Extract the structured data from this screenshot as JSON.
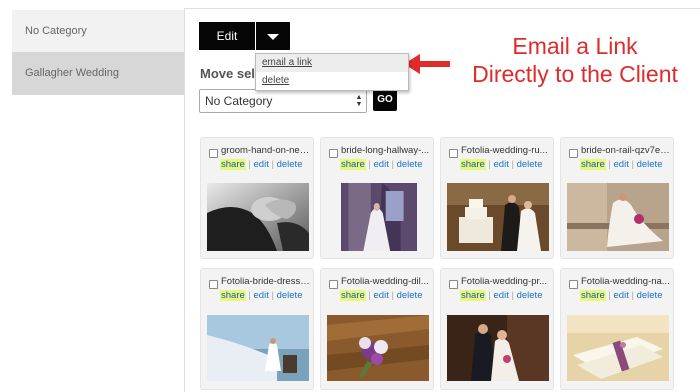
{
  "sidebar": {
    "items": [
      {
        "label": "No Category"
      },
      {
        "label": "Gallagher Wedding"
      }
    ]
  },
  "toolbar": {
    "edit_label": "Edit",
    "menu": {
      "items": [
        {
          "label": "email a link"
        },
        {
          "label": "delete"
        }
      ]
    },
    "move_label": "Move sel",
    "category_select": {
      "value": "No Category"
    },
    "go_label": "GO"
  },
  "annotation": {
    "line1": "Email a Link",
    "line2": "Directly to the Client",
    "color": "#e02b2b"
  },
  "photo_actions": {
    "share": "share",
    "sep": "|",
    "edit": "edit",
    "delete": "delete"
  },
  "photos": [
    {
      "name": "groom-hand-on-nec..."
    },
    {
      "name": "bride-long-hallway-..."
    },
    {
      "name": "Fotolia-wedding-ru..."
    },
    {
      "name": "bride-on-rail-qzv7ev..."
    },
    {
      "name": "Fotolia-bride-dress-..."
    },
    {
      "name": "Fotolia-wedding-dil..."
    },
    {
      "name": "Fotolia-wedding-pr..."
    },
    {
      "name": "Fotolia-wedding-na..."
    }
  ],
  "colors": {
    "share_highlight": "#eaf57a",
    "link": "#1a73c9",
    "button": "#050505"
  }
}
